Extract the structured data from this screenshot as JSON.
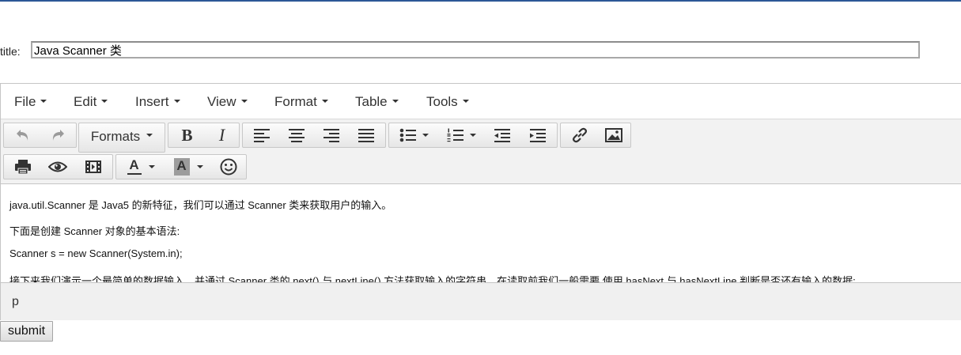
{
  "form": {
    "title_label": "title:",
    "title_value": "Java Scanner 类",
    "submit_label": "submit"
  },
  "menubar": {
    "items": [
      "File",
      "Edit",
      "Insert",
      "View",
      "Format",
      "Table",
      "Tools"
    ]
  },
  "toolbar": {
    "formats_label": "Formats",
    "icons": [
      "undo-icon",
      "redo-icon",
      "bold-icon",
      "italic-icon",
      "align-left-icon",
      "align-center-icon",
      "align-right-icon",
      "align-justify-icon",
      "bullet-list-icon",
      "numbered-list-icon",
      "outdent-icon",
      "indent-icon",
      "link-icon",
      "image-icon",
      "print-icon",
      "preview-icon",
      "media-icon",
      "text-color-icon",
      "background-color-icon",
      "emoticons-icon"
    ],
    "bold_glyph": "B",
    "italic_glyph": "I",
    "text_color_glyph": "A",
    "bg_color_glyph": "A"
  },
  "content": {
    "paragraphs": [
      "java.util.Scanner 是 Java5 的新特征，我们可以通过 Scanner 类来获取用户的输入。",
      "下面是创建 Scanner 对象的基本语法:",
      "Scanner s = new Scanner(System.in);",
      "接下来我们演示一个最简单的数据输入，并通过 Scanner 类的 next() 与 nextLine() 方法获取输入的字符串，在读取前我们一般需要 使用 hasNext 与 hasNextLine 判断是否还有输入的数据:"
    ]
  },
  "statusbar": {
    "path": "p"
  },
  "colors": {
    "accent_line": "#2b5797",
    "toolbar_bg": "#f2f2f2",
    "icon": "#333333"
  }
}
